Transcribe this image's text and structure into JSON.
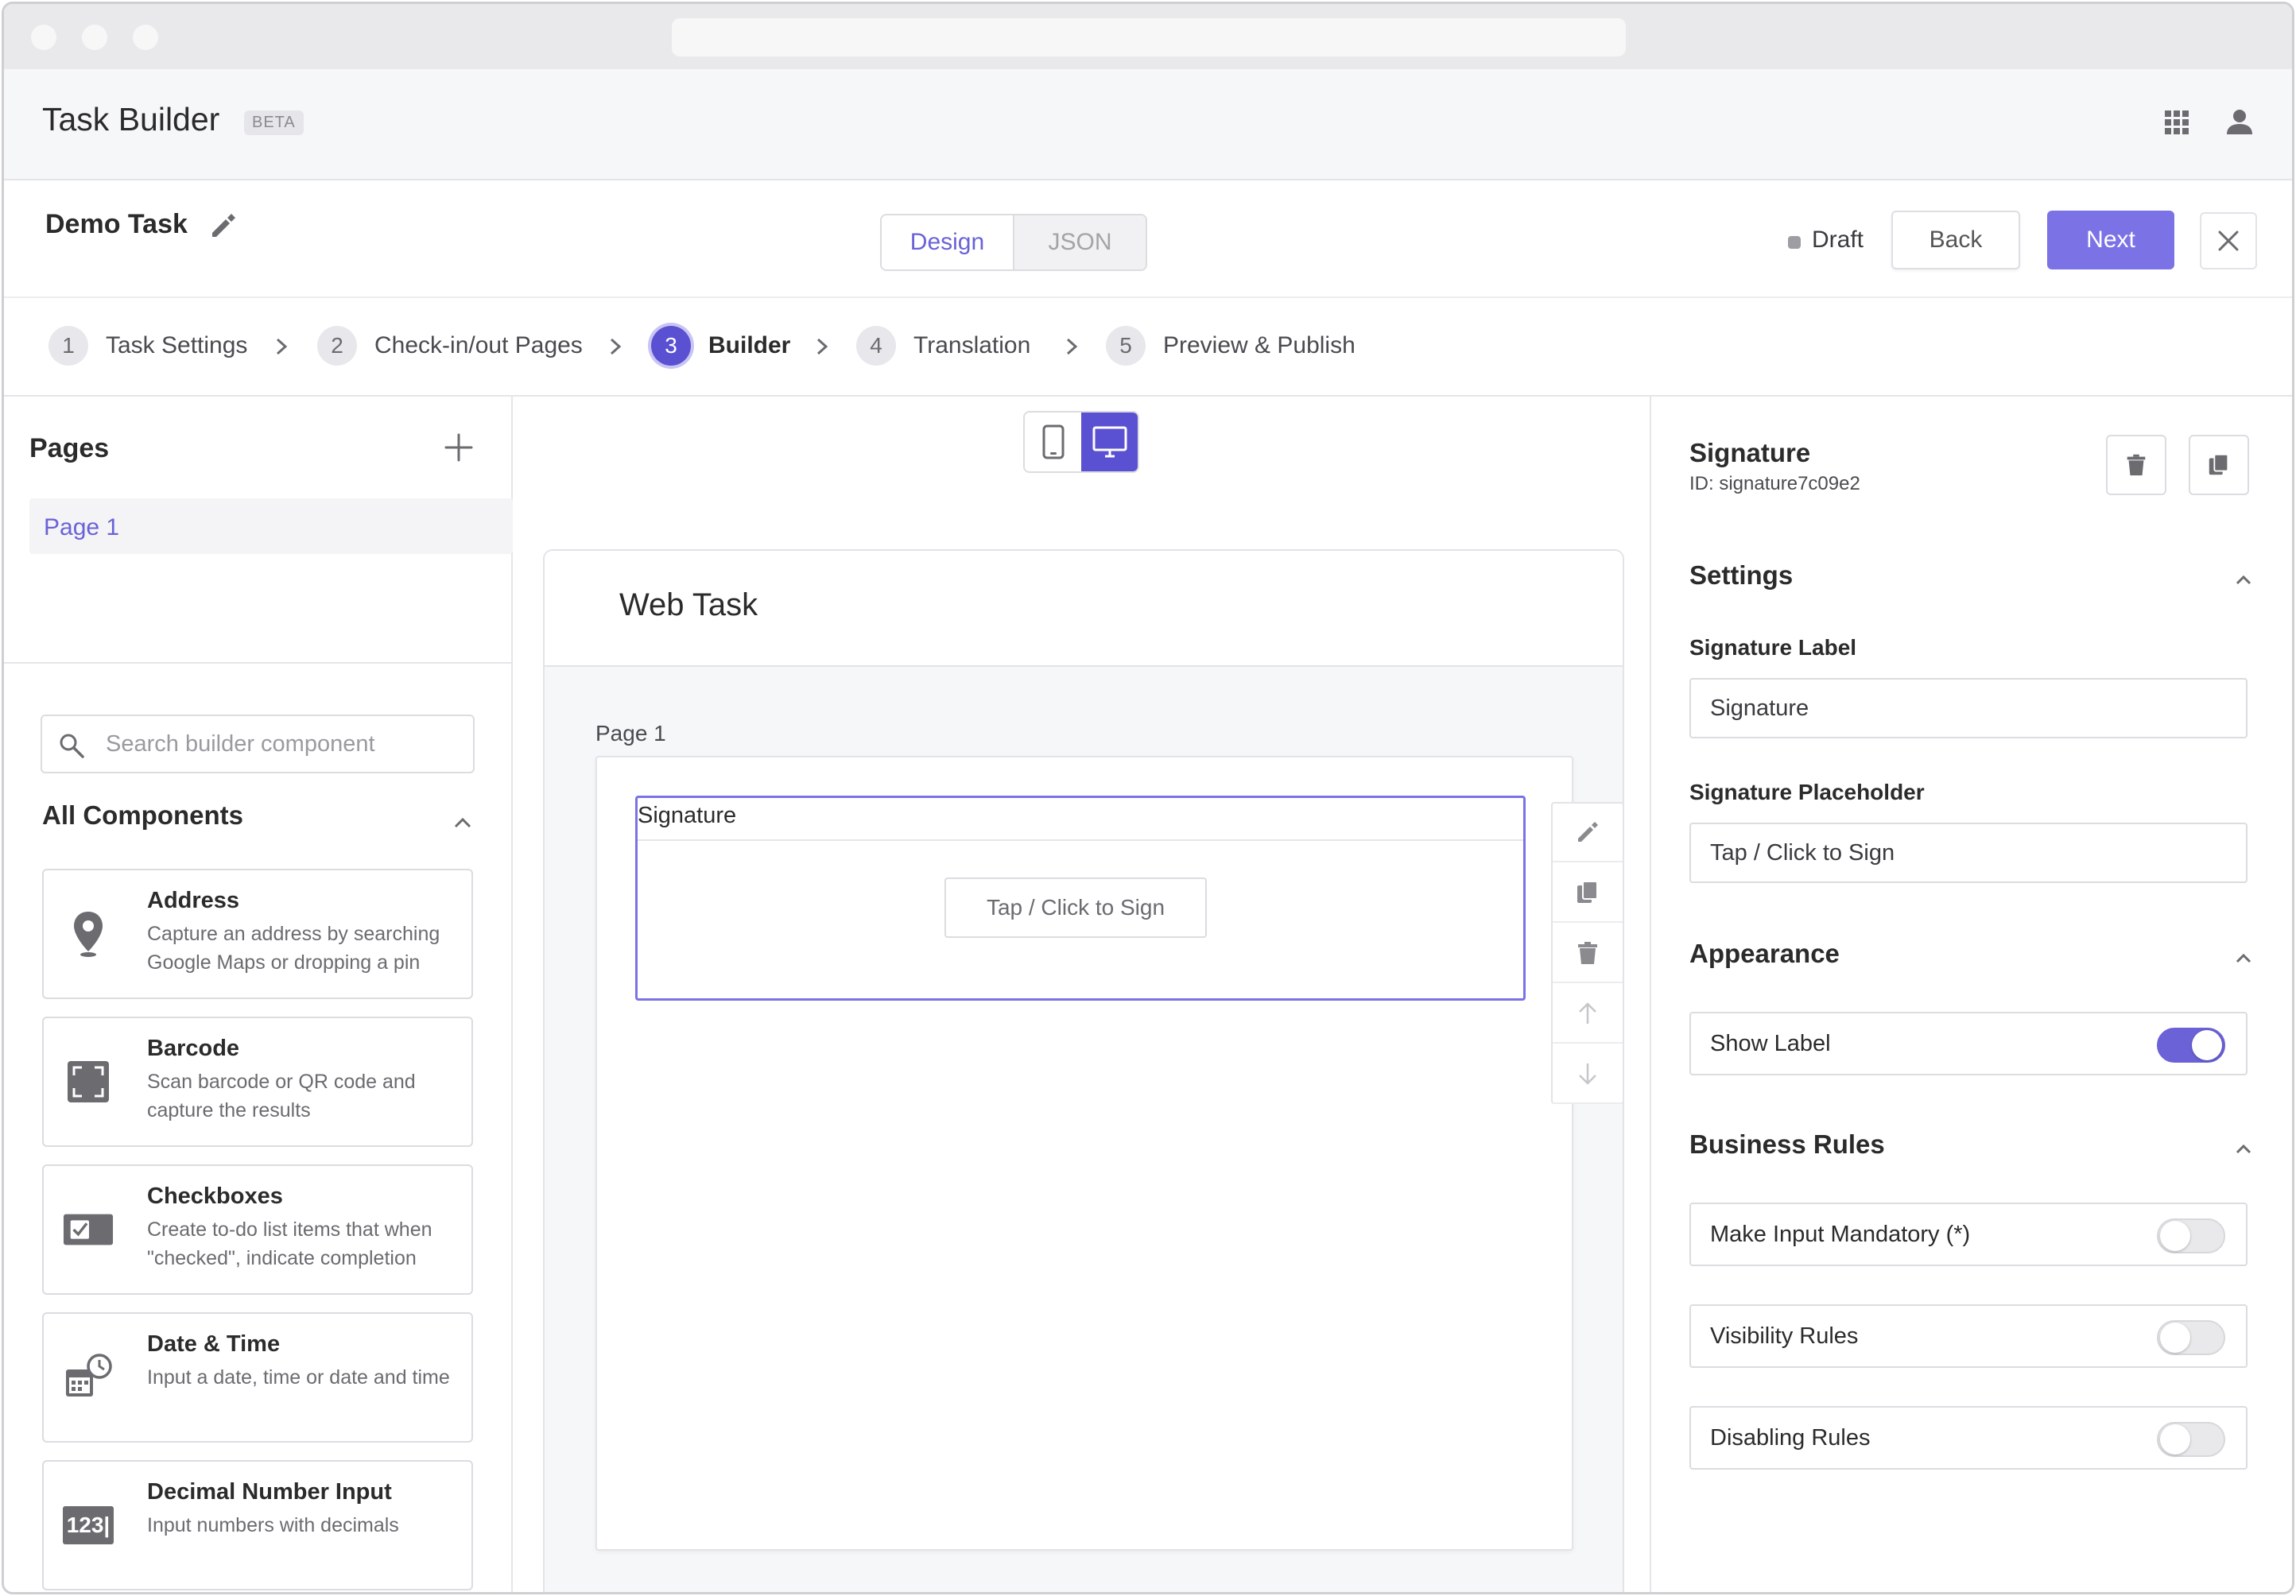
{
  "app": {
    "title": "Task Builder",
    "badge": "BETA"
  },
  "task": {
    "name": "Demo Task",
    "status": "Draft"
  },
  "view_tabs": [
    {
      "label": "Design"
    },
    {
      "label": "JSON"
    }
  ],
  "actions": {
    "back": "Back",
    "next": "Next"
  },
  "steps": [
    {
      "num": "1",
      "label": "Task Settings"
    },
    {
      "num": "2",
      "label": "Check-in/out Pages"
    },
    {
      "num": "3",
      "label": "Builder"
    },
    {
      "num": "4",
      "label": "Translation"
    },
    {
      "num": "5",
      "label": "Preview & Publish"
    }
  ],
  "pages_panel": {
    "title": "Pages",
    "items": [
      {
        "label": "Page 1"
      }
    ]
  },
  "components": {
    "search_placeholder": "Search builder component",
    "title": "All Components",
    "items": [
      {
        "name": "Address",
        "desc": "Capture an address by searching Google Maps or dropping a pin",
        "icon": "map-pin-icon"
      },
      {
        "name": "Barcode",
        "desc": "Scan barcode or QR code and capture the results",
        "icon": "barcode-scan-icon"
      },
      {
        "name": "Checkboxes",
        "desc": "Create to-do list items that when \"checked\", indicate completion",
        "icon": "checkbox-icon"
      },
      {
        "name": "Date & Time",
        "desc": "Input a date, time or date and time",
        "icon": "calendar-clock-icon"
      },
      {
        "name": "Decimal Number Input",
        "desc": "Input numbers with decimals",
        "icon": "number-input-icon",
        "glyph": "123|"
      }
    ]
  },
  "canvas": {
    "title": "Web Task",
    "page_label": "Page 1",
    "field": {
      "label": "Signature",
      "button": "Tap / Click to Sign"
    }
  },
  "inspector": {
    "title": "Signature",
    "id": "ID: signature7c09e2",
    "settings": {
      "title": "Settings",
      "label_title": "Signature Label",
      "label_value": "Signature",
      "placeholder_title": "Signature Placeholder",
      "placeholder_value": "Tap / Click to Sign"
    },
    "appearance": {
      "title": "Appearance",
      "show_label": "Show Label",
      "show_label_on": true
    },
    "business_rules": {
      "title": "Business Rules",
      "items": [
        {
          "label": "Make Input Mandatory (*)",
          "on": false
        },
        {
          "label": "Visibility Rules",
          "on": false
        },
        {
          "label": "Disabling Rules",
          "on": false
        }
      ]
    }
  },
  "colors": {
    "accent": "#5a50d2",
    "accent_light": "#7b72e6",
    "border": "#dcdce1"
  }
}
